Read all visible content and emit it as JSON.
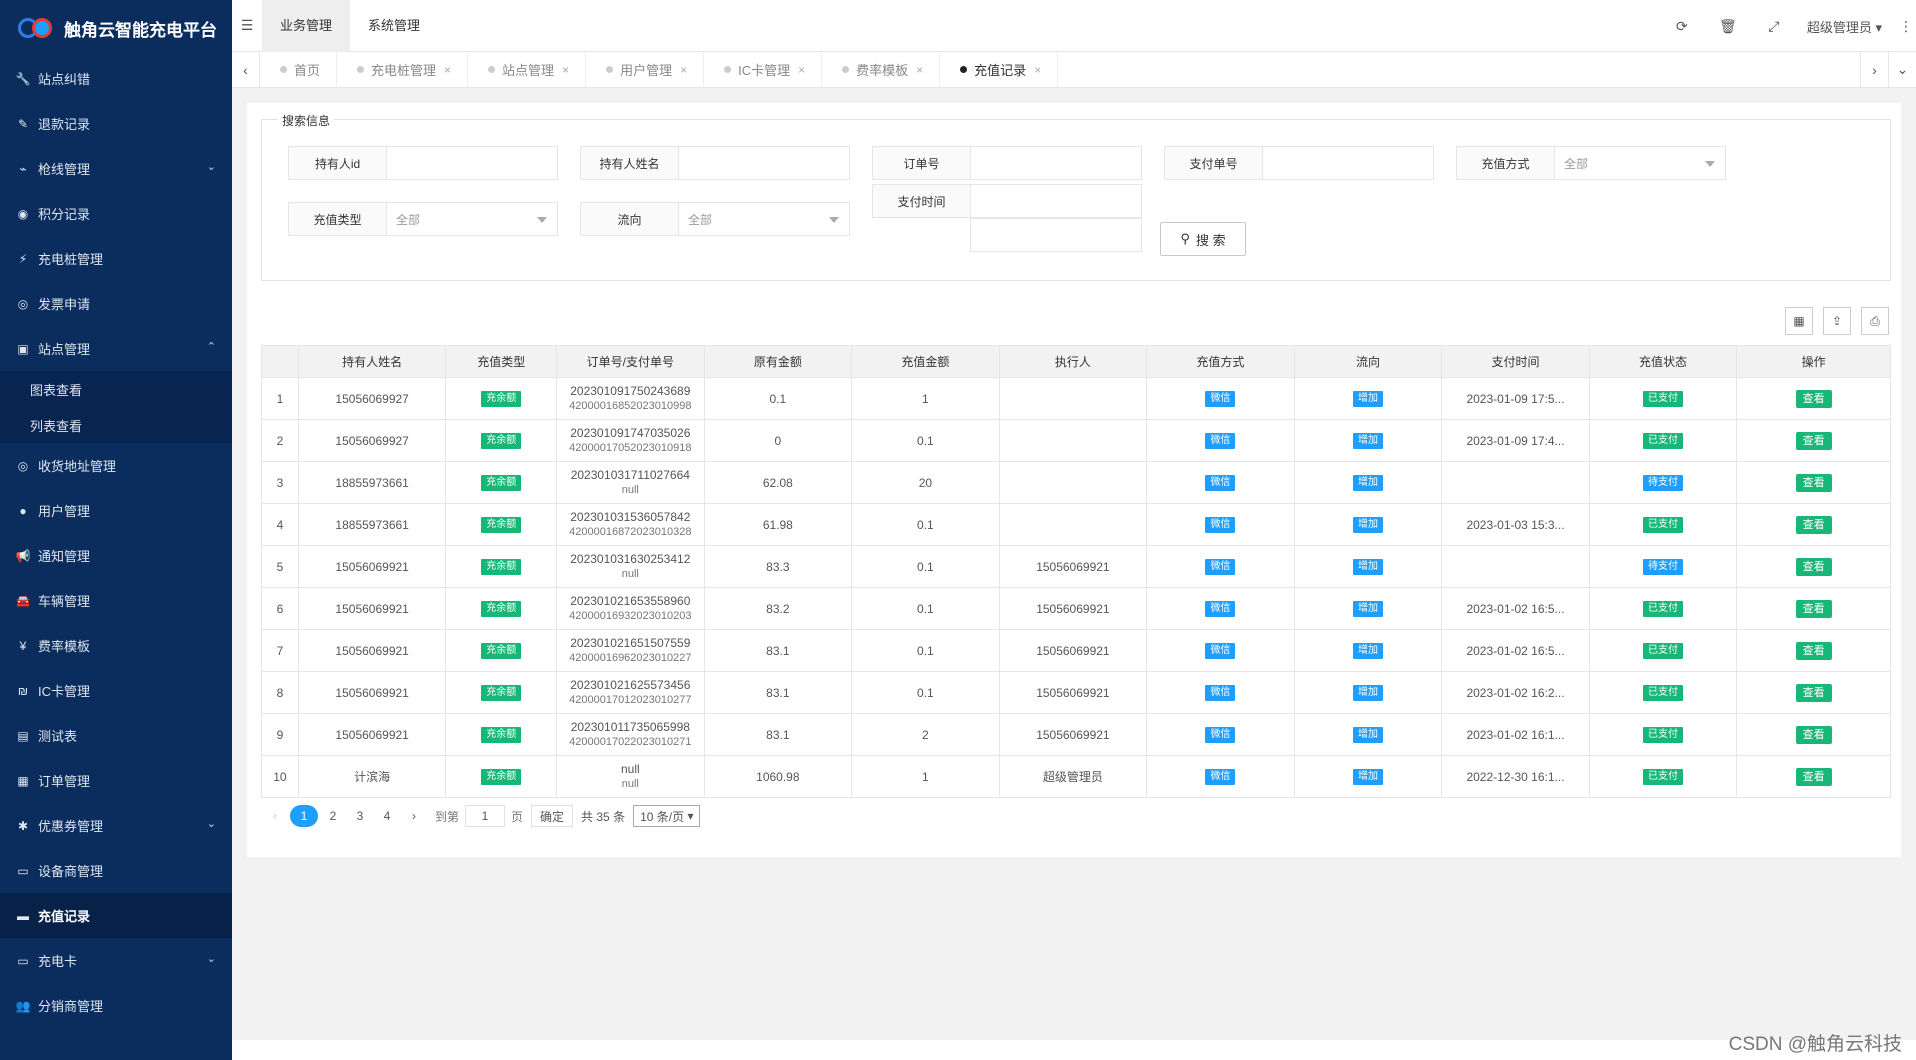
{
  "app": {
    "title": "触角云智能充电平台"
  },
  "sidebar": {
    "items": [
      {
        "label": "站点纠错",
        "icon": "wrench-icon"
      },
      {
        "label": "退款记录",
        "icon": "refund-icon"
      },
      {
        "label": "枪线管理",
        "icon": "connector-icon",
        "arrow": "⌄"
      },
      {
        "label": "积分记录",
        "icon": "points-icon"
      },
      {
        "label": "充电桩管理",
        "icon": "charger-icon"
      },
      {
        "label": "发票申请",
        "icon": "invoice-icon"
      },
      {
        "label": "站点管理",
        "icon": "station-icon",
        "arrow": "⌃"
      }
    ],
    "sub_items": [
      {
        "label": "图表查看"
      },
      {
        "label": "列表查看"
      }
    ],
    "items2": [
      {
        "label": "收货地址管理",
        "icon": "address-icon"
      },
      {
        "label": "用户管理",
        "icon": "user-icon"
      },
      {
        "label": "通知管理",
        "icon": "megaphone-icon"
      },
      {
        "label": "车辆管理",
        "icon": "car-icon"
      },
      {
        "label": "费率模板",
        "icon": "yen-icon"
      },
      {
        "label": "IC卡管理",
        "icon": "ic-card-icon"
      },
      {
        "label": "测试表",
        "icon": "test-table-icon"
      },
      {
        "label": "订单管理",
        "icon": "order-icon"
      },
      {
        "label": "优惠券管理",
        "icon": "coupon-icon",
        "arrow": "⌄"
      },
      {
        "label": "设备商管理",
        "icon": "vendor-icon"
      },
      {
        "label": "充值记录",
        "icon": "visa-card-icon",
        "active": true
      },
      {
        "label": "充电卡",
        "icon": "card-icon",
        "arrow": "⌄"
      },
      {
        "label": "分销商管理",
        "icon": "distributor-icon"
      }
    ]
  },
  "topbar": {
    "tabs": [
      "业务管理",
      "系统管理"
    ],
    "user": "超级管理员"
  },
  "pagetabs": [
    "首页",
    "充电桩管理",
    "站点管理",
    "用户管理",
    "IC卡管理",
    "费率模板",
    "充值记录"
  ],
  "search": {
    "legend": "搜索信息",
    "holder_id": "持有人id",
    "holder_name": "持有人姓名",
    "order_no": "订单号",
    "pay_no": "支付单号",
    "pay_method": "充值方式",
    "pay_method_val": "全部",
    "recharge_type": "充值类型",
    "recharge_type_val": "全部",
    "flow": "流向",
    "flow_val": "全部",
    "pay_time": "支付时间",
    "button": "搜 索"
  },
  "table": {
    "headers": [
      "",
      "持有人姓名",
      "充值类型",
      "订单号/支付单号",
      "原有金额",
      "充值金额",
      "执行人",
      "充值方式",
      "流向",
      "支付时间",
      "充值状态",
      "操作"
    ],
    "rows": [
      {
        "n": "1",
        "name": "15056069927",
        "type": "充余额",
        "o1": "202301091750243689",
        "o2": "42000016852023010998",
        "orig": "0.1",
        "amt": "1",
        "exec": "",
        "method": "微信",
        "flow": "增加",
        "time": "2023-01-09 17:5...",
        "status": "已支付",
        "op": "查看"
      },
      {
        "n": "2",
        "name": "15056069927",
        "type": "充余额",
        "o1": "202301091747035026",
        "o2": "42000017052023010918",
        "orig": "0",
        "amt": "0.1",
        "exec": "",
        "method": "微信",
        "flow": "增加",
        "time": "2023-01-09 17:4...",
        "status": "已支付",
        "op": "查看"
      },
      {
        "n": "3",
        "name": "18855973661",
        "type": "充余额",
        "o1": "202301031711027664",
        "o2": "null",
        "orig": "62.08",
        "amt": "20",
        "exec": "",
        "method": "微信",
        "flow": "增加",
        "time": "",
        "status": "待支付",
        "op": "查看"
      },
      {
        "n": "4",
        "name": "18855973661",
        "type": "充余额",
        "o1": "202301031536057842",
        "o2": "42000016872023010328",
        "orig": "61.98",
        "amt": "0.1",
        "exec": "",
        "method": "微信",
        "flow": "增加",
        "time": "2023-01-03 15:3...",
        "status": "已支付",
        "op": "查看"
      },
      {
        "n": "5",
        "name": "15056069921",
        "type": "充余额",
        "o1": "202301031630253412",
        "o2": "null",
        "orig": "83.3",
        "amt": "0.1",
        "exec": "15056069921",
        "method": "微信",
        "flow": "增加",
        "time": "",
        "status": "待支付",
        "op": "查看"
      },
      {
        "n": "6",
        "name": "15056069921",
        "type": "充余额",
        "o1": "202301021653558960",
        "o2": "42000016932023010203",
        "orig": "83.2",
        "amt": "0.1",
        "exec": "15056069921",
        "method": "微信",
        "flow": "增加",
        "time": "2023-01-02 16:5...",
        "status": "已支付",
        "op": "查看"
      },
      {
        "n": "7",
        "name": "15056069921",
        "type": "充余额",
        "o1": "202301021651507559",
        "o2": "42000016962023010227",
        "orig": "83.1",
        "amt": "0.1",
        "exec": "15056069921",
        "method": "微信",
        "flow": "增加",
        "time": "2023-01-02 16:5...",
        "status": "已支付",
        "op": "查看"
      },
      {
        "n": "8",
        "name": "15056069921",
        "type": "充余额",
        "o1": "202301021625573456",
        "o2": "42000017012023010277",
        "orig": "83.1",
        "amt": "0.1",
        "exec": "15056069921",
        "method": "微信",
        "flow": "增加",
        "time": "2023-01-02 16:2...",
        "status": "已支付",
        "op": "查看"
      },
      {
        "n": "9",
        "name": "15056069921",
        "type": "充余额",
        "o1": "202301011735065998",
        "o2": "42000017022023010271",
        "orig": "83.1",
        "amt": "2",
        "exec": "15056069921",
        "method": "微信",
        "flow": "增加",
        "time": "2023-01-02 16:1...",
        "status": "已支付",
        "op": "查看"
      },
      {
        "n": "10",
        "name": "计滨海",
        "type": "充余额",
        "o1": "null",
        "o2": "null",
        "orig": "1060.98",
        "amt": "1",
        "exec": "超级管理员",
        "method": "微信",
        "flow": "增加",
        "time": "2022-12-30 16:1...",
        "status": "已支付",
        "op": "查看"
      }
    ]
  },
  "pager": {
    "pages": [
      "1",
      "2",
      "3",
      "4"
    ],
    "goto": "到第",
    "goto_val": "1",
    "page_unit": "页",
    "ok": "确定",
    "total": "共 35 条",
    "size": "10 条/页"
  },
  "watermark": "CSDN @触角云科技"
}
